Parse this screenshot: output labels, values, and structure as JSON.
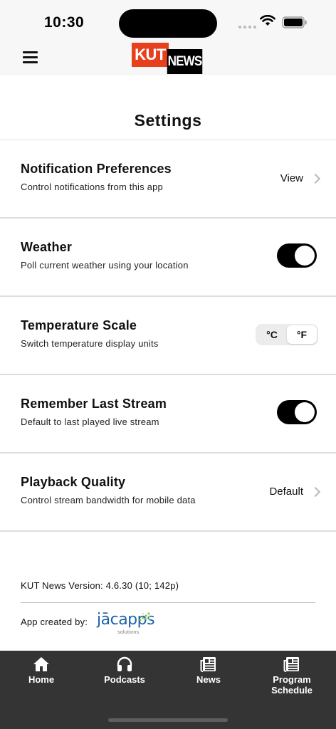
{
  "status_bar": {
    "time": "10:30"
  },
  "header": {
    "logo_kut": "KUT",
    "logo_news": "NEWS",
    "title": "Settings"
  },
  "settings": [
    {
      "title": "Notification Preferences",
      "description": "Control notifications from this app",
      "control": "link",
      "value": "View"
    },
    {
      "title": "Weather",
      "description": "Poll current weather using your location",
      "control": "toggle",
      "on": true
    },
    {
      "title": "Temperature Scale",
      "description": "Switch temperature display units",
      "control": "segmented",
      "options": [
        "°C",
        "°F"
      ],
      "selected": "°F"
    },
    {
      "title": "Remember Last Stream",
      "description": "Default to last played live stream",
      "control": "toggle",
      "on": true
    },
    {
      "title": "Playback Quality",
      "description": "Control stream bandwidth for mobile data",
      "control": "link",
      "value": "Default"
    }
  ],
  "footer": {
    "version": "KUT News Version: 4.6.30 (10; 142p)",
    "credit_label": "App created by:",
    "credit_logo_word": "jācapps",
    "credit_logo_sub": "solutions"
  },
  "tabs": [
    {
      "label": "Home",
      "icon": "home-icon"
    },
    {
      "label": "Podcasts",
      "icon": "headphones-icon"
    },
    {
      "label": "News",
      "icon": "newspaper-icon"
    },
    {
      "label": "Program Schedule",
      "icon": "schedule-icon"
    }
  ],
  "colors": {
    "brand_red": "#e8401c",
    "tab_bar_bg": "#343434",
    "toggle_on": "#000000",
    "jacapps_blue": "#1b62a8",
    "jacapps_green": "#7cc142"
  }
}
